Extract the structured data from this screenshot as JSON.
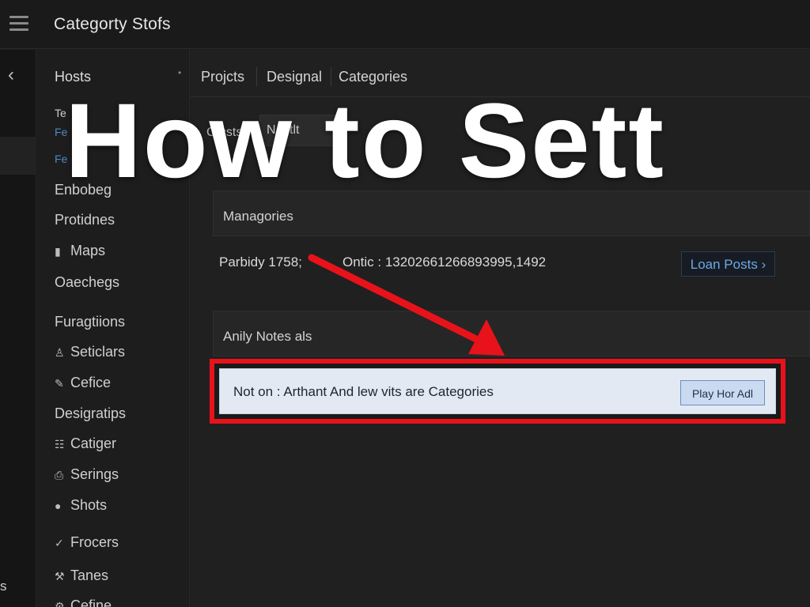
{
  "app": {
    "title": "Categorty Stofs"
  },
  "rail": {
    "bottom_text": "s"
  },
  "sidebar": {
    "header": "Hosts",
    "header_dot": "•",
    "sub_items": [
      "Te",
      "Fe",
      "Fe"
    ],
    "items": [
      {
        "label": "Enbobeg",
        "icon": ""
      },
      {
        "label": "Protidnes",
        "icon": ""
      },
      {
        "label": "Maps",
        "icon": "map-icon",
        "glyph": "▮"
      },
      {
        "label": "Oaechegs",
        "icon": ""
      },
      {
        "label": "Furagtiions",
        "icon": ""
      },
      {
        "label": "Seticlars",
        "icon": "lock-icon",
        "glyph": "♙"
      },
      {
        "label": "Cefice",
        "icon": "pencil-icon",
        "glyph": "✎"
      },
      {
        "label": "Desigratips",
        "icon": ""
      },
      {
        "label": "Catiger",
        "icon": "grid-icon",
        "glyph": "☷"
      },
      {
        "label": "Serings",
        "icon": "clipboard-icon",
        "glyph": "⎙"
      },
      {
        "label": "Shots",
        "icon": "info-icon",
        "glyph": "●"
      },
      {
        "label": "Frocers",
        "icon": "check-icon",
        "glyph": "✓"
      },
      {
        "label": "Tanes",
        "icon": "wrench-icon",
        "glyph": "⚒"
      },
      {
        "label": "Cefine",
        "icon": "settings-icon",
        "glyph": "⚙"
      }
    ]
  },
  "tabs": [
    "Projcts",
    "Designal",
    "Categories"
  ],
  "field": {
    "label": "Crcsts",
    "value": "N Tltlt"
  },
  "panel1": {
    "title": "Managories"
  },
  "row": {
    "left_text": "Parbidy 1758;",
    "right_text": "Ontic : 13202661266893995,1492",
    "button_label": "Loan Posts",
    "button_icon": "›"
  },
  "panel2": {
    "title": "Anily Notes als"
  },
  "notice": {
    "text": "Not on : Arthant And lew vits are Categories",
    "button_label": "Play Hor Adl"
  },
  "overlay": {
    "heading": "How to Sett"
  },
  "colors": {
    "highlight": "#e8121b",
    "arrow": "#e8121b",
    "accent": "#4d86c2"
  }
}
